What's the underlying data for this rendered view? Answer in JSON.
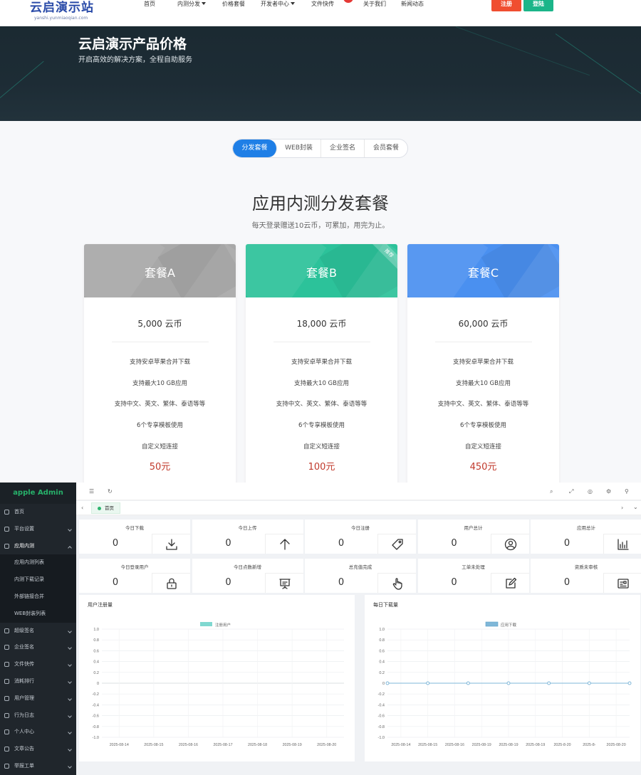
{
  "site": {
    "logo": {
      "main": "云启演示站",
      "sub": "yanshi.yunmiaoqian.com"
    },
    "nav": [
      {
        "label": "首页",
        "caret": false
      },
      {
        "label": "内测分发",
        "caret": true
      },
      {
        "label": "价格套餐",
        "caret": false
      },
      {
        "label": "开发者中心",
        "caret": true
      },
      {
        "label": "文件快传",
        "caret": false
      },
      {
        "label": "关于我们",
        "caret": false
      },
      {
        "label": "新闻动态",
        "caret": false
      }
    ],
    "register_label": "注册",
    "login_label": "登陆",
    "hero": {
      "title": "云启演示产品价格",
      "subtitle": "开启高效的解决方案，全程自助服务"
    },
    "tabs": [
      {
        "label": "分发套餐",
        "active": true
      },
      {
        "label": "WEB封装",
        "active": false
      },
      {
        "label": "企业签名",
        "active": false
      },
      {
        "label": "会员套餐",
        "active": false
      }
    ],
    "section": {
      "title": "应用内测分发套餐",
      "subtitle": "每天登录赠送10云币，可累加，用完为止。"
    },
    "plans": [
      {
        "name": "套餐A",
        "coins": "5,000 云币",
        "price": "50元",
        "badge": "",
        "color": "#a8a8a8",
        "features": [
          "支持安卓苹果合并下载",
          "支持最大10 GB应用",
          "支持中文、英文、繁体、泰语等等",
          "6个专享模板使用",
          "自定义短连接"
        ]
      },
      {
        "name": "套餐B",
        "coins": "18,000 云币",
        "price": "100元",
        "badge": "推荐",
        "color": "#2cc29a",
        "features": [
          "支持安卓苹果合并下载",
          "支持最大10 GB应用",
          "支持中文、英文、繁体、泰语等等",
          "6个专享模板使用",
          "自定义短连接"
        ]
      },
      {
        "name": "套餐C",
        "coins": "60,000 云币",
        "price": "450元",
        "badge": "",
        "color": "#4a90f0",
        "features": [
          "支持安卓苹果合并下载",
          "支持最大10 GB应用",
          "支持中文、英文、繁体、泰语等等",
          "6个专享模板使用",
          "自定义短连接"
        ]
      }
    ]
  },
  "admin": {
    "brand": "apple Admin",
    "menu": [
      {
        "label": "首页",
        "chevron": false,
        "open": false
      },
      {
        "label": "平台设置",
        "chevron": true,
        "open": false
      },
      {
        "label": "应用内测",
        "chevron": true,
        "open": true,
        "children": [
          "应用内测列表",
          "内测下载记录",
          "外部链接合并",
          "WEB封装列表"
        ]
      },
      {
        "label": "超级签名",
        "chevron": true,
        "open": false
      },
      {
        "label": "企业签名",
        "chevron": true,
        "open": false
      },
      {
        "label": "文件快传",
        "chevron": true,
        "open": false
      },
      {
        "label": "消耗排行",
        "chevron": true,
        "open": false
      },
      {
        "label": "用户管理",
        "chevron": true,
        "open": false
      },
      {
        "label": "行为日志",
        "chevron": true,
        "open": false
      },
      {
        "label": "个人中心",
        "chevron": true,
        "open": false
      },
      {
        "label": "文章公告",
        "chevron": true,
        "open": false
      },
      {
        "label": "举报工单",
        "chevron": true,
        "open": false
      }
    ],
    "home_tag": "首页",
    "stats": [
      {
        "label": "今日下载",
        "value": "0",
        "icon": "download-icon"
      },
      {
        "label": "今日上传",
        "value": "0",
        "icon": "upload-arrow-icon"
      },
      {
        "label": "今日注册",
        "value": "0",
        "icon": "tag-icon"
      },
      {
        "label": "用户总计",
        "value": "0",
        "icon": "user-circle-icon"
      },
      {
        "label": "应用总计",
        "value": "0",
        "icon": "bar-chart-icon"
      },
      {
        "label": "今日登录用户",
        "value": "0",
        "icon": "lock-icon"
      },
      {
        "label": "今日点数新增",
        "value": "0",
        "icon": "presentation-icon"
      },
      {
        "label": "总充值完成",
        "value": "0",
        "icon": "hand-pointer-icon"
      },
      {
        "label": "工单未处理",
        "value": "0",
        "icon": "edit-icon"
      },
      {
        "label": "资质未审核",
        "value": "0",
        "icon": "id-card-icon"
      }
    ]
  },
  "chart_data": [
    {
      "type": "line",
      "title": "用户注册量",
      "x": [
        "2025-08-14",
        "2025-08-15",
        "2025-08-16",
        "2025-08-17",
        "2025-08-18",
        "2025-08-19",
        "2025-08-20"
      ],
      "series": [
        {
          "name": "注册用户",
          "values": [
            0,
            0,
            0,
            0,
            0,
            0,
            0
          ],
          "color": "#7fd8d0"
        }
      ],
      "yticks": [
        "1.0",
        "0.8",
        "0.6",
        "0.4",
        "0.2",
        "0",
        "-0.2",
        "-0.4",
        "-0.6",
        "-0.8",
        "-1.0"
      ],
      "ylim": [
        -1,
        1
      ],
      "grid": true,
      "legend": "top-center",
      "show_markers": false
    },
    {
      "type": "line",
      "title": "每日下载量",
      "x": [
        "2025-08-14",
        "2025-08-15",
        "2025-08-16",
        "2025-08-19",
        "2025-08-19",
        "2025-08-19",
        "2025-8-20",
        "2025-8-",
        "2025-08-20"
      ],
      "series": [
        {
          "name": "应用下载",
          "values": [
            0,
            0,
            0,
            0,
            0,
            0,
            0
          ],
          "color": "#7fb7d8"
        }
      ],
      "yticks": [
        "1.0",
        "0.8",
        "0.6",
        "0.4",
        "0.2",
        "0",
        "-0.2",
        "-0.4",
        "-0.6",
        "-0.8",
        "-1.0"
      ],
      "ylim": [
        -1,
        1
      ],
      "grid": true,
      "legend": "top-center",
      "show_markers": true
    }
  ]
}
